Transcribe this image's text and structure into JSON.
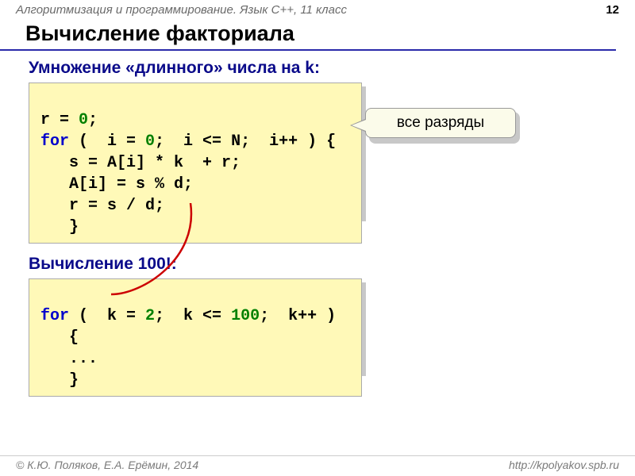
{
  "header": {
    "course": "Алгоритмизация и программирование. Язык С++, 11 класс",
    "page": "12"
  },
  "title": "Вычисление факториала",
  "section1": {
    "heading": "Умножение «длинного» числа на k:",
    "code": {
      "l1a": "r = ",
      "l1n": "0",
      "l1b": ";",
      "l2kw": "for",
      "l2a": " (  i = ",
      "l2n": "0",
      "l2b": ";  i <= N;  i++ ) {",
      "l3": "   s = A[i] * k  + r;",
      "l4": "   A[i] = s % d;",
      "l5": "   r = s / d;",
      "l6": "   }"
    },
    "callout": "все разряды"
  },
  "section2": {
    "heading": "Вычисление 100!:",
    "code": {
      "l1kw": "for",
      "l1a": " (  k = ",
      "l1n1": "2",
      "l1b": ";  k <= ",
      "l1n2": "100",
      "l1c": ";  k++ )",
      "l2": "   {",
      "l3": "   ...",
      "l4": "   }"
    }
  },
  "footer": {
    "left": "© К.Ю. Поляков, Е.А. Ерёмин, 2014",
    "right": "http://kpolyakov.spb.ru"
  }
}
